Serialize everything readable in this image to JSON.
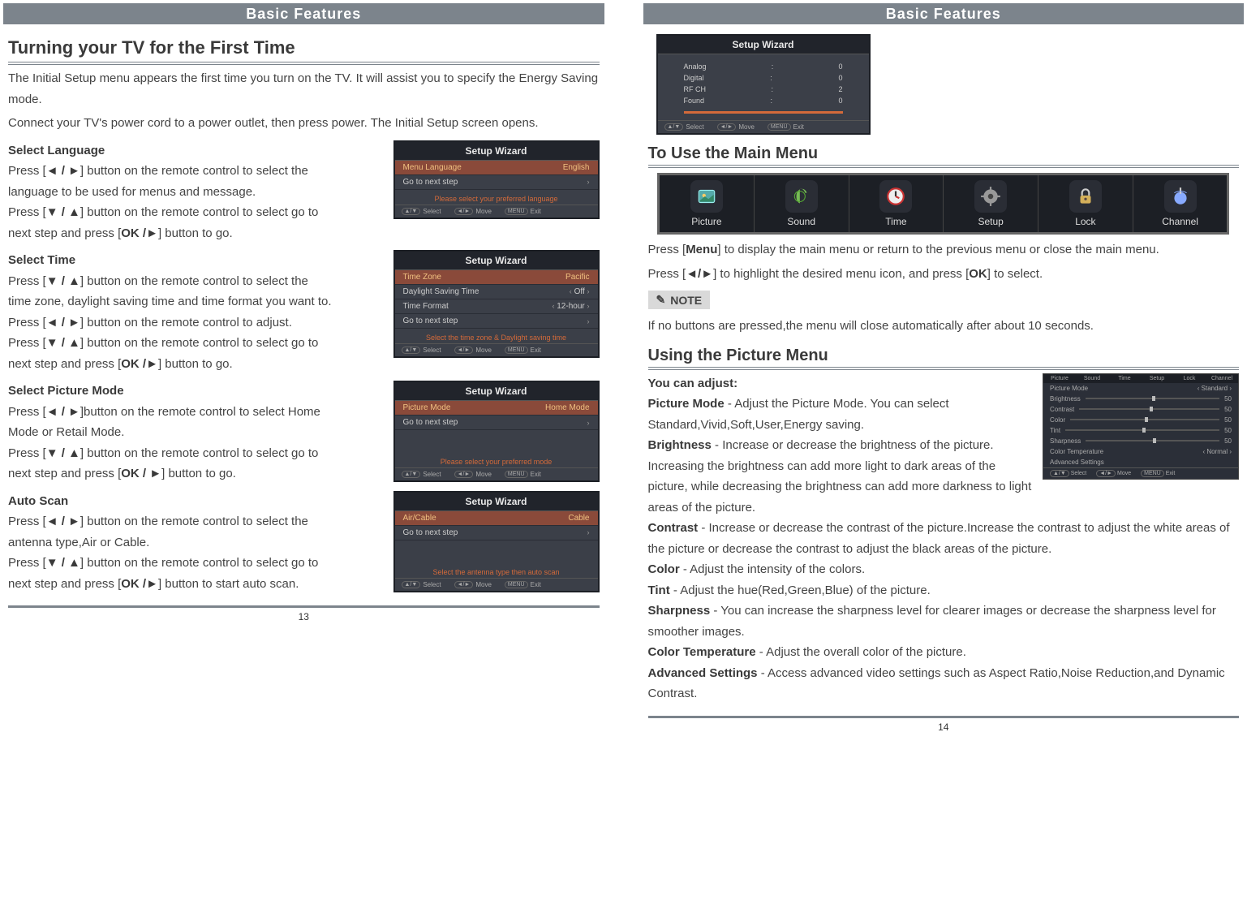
{
  "header_title": "Basic Features",
  "page13": {
    "title": "Turning your TV for the First Time",
    "intro1": "The Initial Setup menu appears the first time you turn on the TV. It will assist you to specify the Energy Saving mode.",
    "intro2": "Connect your TV's power cord to a power outlet, then press power. The Initial Setup screen opens.",
    "lang": {
      "title": "Select Language",
      "p1a": "Press [",
      "p1b": "◄ / ►",
      "p1c": "] button on the remote control to select the language to be used for menus and message.",
      "p2a": "Press [",
      "p2b": "▼ / ▲",
      "p2c": "] button on the remote control to select go to next step and press [",
      "p2d": "OK /►",
      "p2e": "] button to go.",
      "wizard": {
        "title": "Setup Wizard",
        "row1_label": "Menu Language",
        "row1_value": "English",
        "row2_label": "Go to next step",
        "hint": "Please select your preferred language",
        "foot_select": "Select",
        "foot_move": "Move",
        "foot_exit": "Exit"
      }
    },
    "time": {
      "title": "Select Time",
      "p1a": "Press [",
      "p1b": "▼ / ▲",
      "p1c": "] button on the remote control to select the time zone, daylight saving time and time format you want to.",
      "p2a": "Press [",
      "p2b": "◄ / ►",
      "p2c": "] button on the remote control to adjust.",
      "p3a": "Press [",
      "p3b": "▼ / ▲",
      "p3c": "] button on the remote control to select go to next step and press [",
      "p3d": "OK /►",
      "p3e": "] button to go.",
      "wizard": {
        "title": "Setup Wizard",
        "r1l": "Time Zone",
        "r1v": "Pacific",
        "r2l": "Daylight Saving Time",
        "r2v": "Off",
        "r3l": "Time Format",
        "r3v": "12-hour",
        "r4l": "Go to next step",
        "hint": "Select the time zone & Daylight saving time"
      }
    },
    "mode": {
      "title": "Select Picture Mode",
      "p1a": "Press [",
      "p1b": "◄ / ►",
      "p1c": "]button on the remote control to select Home Mode or Retail Mode.",
      "p2a": "Press [",
      "p2b": "▼ / ▲",
      "p2c": "] button on the remote control to select go to next step and press [",
      "p2d": "OK / ►",
      "p2e": "] button to go.",
      "wizard": {
        "title": "Setup Wizard",
        "r1l": "Picture Mode",
        "r1v": "Home Mode",
        "r2l": "Go to next step",
        "hint": "Please select your preferred mode"
      }
    },
    "scan": {
      "title": "Auto Scan",
      "p1a": "Press [",
      "p1b": "◄ / ►",
      "p1c": "] button on the remote control to select the antenna type,Air or Cable.",
      "p2a": "Press [",
      "p2b": "▼ / ▲",
      "p2c": "] button on the remote control to select go to next step and press [",
      "p2d": "OK /►",
      "p2e": "] button to start auto scan.",
      "wizard": {
        "title": "Setup Wizard",
        "r1l": "Air/Cable",
        "r1v": "Cable",
        "r2l": "Go to next step",
        "hint": "Select the antenna type then auto scan"
      }
    },
    "page_num": "13"
  },
  "page14": {
    "scan_result": {
      "title": "Setup Wizard",
      "rows": [
        {
          "l": "Analog",
          "v": "0"
        },
        {
          "l": "Digital",
          "v": "0"
        },
        {
          "l": "RF CH",
          "v": "2"
        },
        {
          "l": "Found",
          "v": "0"
        }
      ]
    },
    "main_menu_heading": "To Use the Main Menu",
    "main_items": [
      {
        "name": "Picture",
        "icon": "picture"
      },
      {
        "name": "Sound",
        "icon": "sound"
      },
      {
        "name": "Time",
        "icon": "time"
      },
      {
        "name": "Setup",
        "icon": "setup"
      },
      {
        "name": "Lock",
        "icon": "lock"
      },
      {
        "name": "Channel",
        "icon": "channel"
      }
    ],
    "mm_p1a": "Press [",
    "mm_p1b": "Menu",
    "mm_p1c": "] to display the main menu or return to the previous menu or close the main menu.",
    "mm_p2a": "Press [",
    "mm_p2b": "◄/►",
    "mm_p2c": "] to highlight the desired menu icon, and press [",
    "mm_p2d": "OK",
    "mm_p2e": "] to select.",
    "note_label": "NOTE",
    "note_text": "If no buttons are pressed,the menu will close automatically after about 10 seconds.",
    "picture_heading": "Using the Picture Menu",
    "adjust_lead": "You can adjust:",
    "pm": {
      "mode_l": "Picture Mode",
      "mode_t": " - Adjust the Picture Mode. You can select Standard,Vivid,Soft,User,Energy saving.",
      "bright_l": "Brightness",
      "bright_t": " - Increase or decrease the brightness of the picture. Increasing the brightness can add more light to dark areas of the picture, while decreasing the brightness can add more darkness to light areas of the picture.",
      "contrast_l": "Contrast",
      "contrast_t": " - Increase or decrease the contrast of the picture.Increase the contrast to adjust the white areas of the picture or decrease the contrast to adjust the black areas of the picture.",
      "color_l": "Color",
      "color_t": " - Adjust the intensity of the colors.",
      "tint_l": "Tint",
      "tint_t": " - Adjust the hue(Red,Green,Blue) of the picture.",
      "sharp_l": "Sharpness",
      "sharp_t": " - You can increase the sharpness level for clearer images or decrease the sharpness level for smoother images.",
      "ct_l": "Color Temperature",
      "ct_t": " - Adjust the overall color of the picture.",
      "adv_l": "Advanced Settings",
      "adv_t": " - Access advanced video settings such as Aspect Ratio,Noise Reduction,and Dynamic Contrast."
    },
    "picmock": {
      "row_mode_l": "Picture Mode",
      "row_mode_v": "Standard",
      "row_b": "Brightness",
      "row_b_v": "50",
      "row_c": "Contrast",
      "row_c_v": "50",
      "row_col": "Color",
      "row_col_v": "50",
      "row_t": "Tint",
      "row_t_v": "50",
      "row_s": "Sharpness",
      "row_s_v": "50",
      "row_ct_l": "Color Temperature",
      "row_ct_v": "Normal",
      "row_adv": "Advanced Settings",
      "foot_select": "Select",
      "foot_move": "Move",
      "foot_exit": "Exit"
    },
    "page_num": "14"
  },
  "pill_av": "▲/▼",
  "pill_lr": "◄/►",
  "pill_menu": "MENU"
}
